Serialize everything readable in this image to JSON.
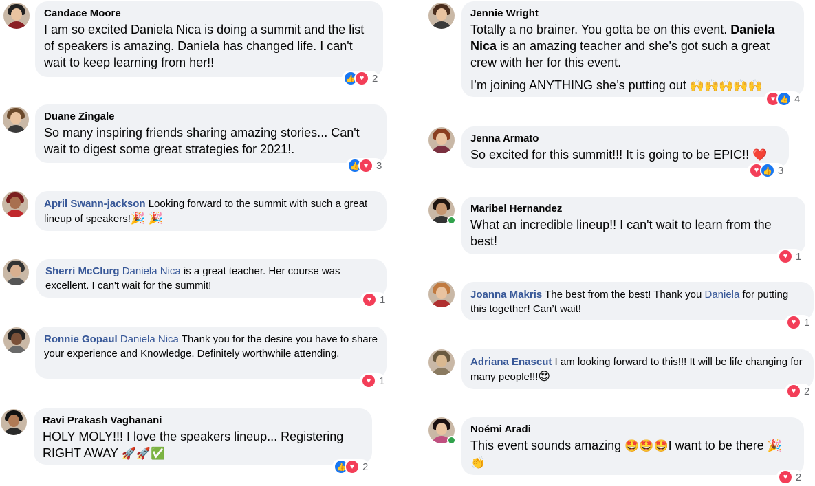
{
  "colors": {
    "bubble": "#f0f2f5",
    "link": "#385898",
    "like": "#1877f2",
    "love": "#f33e58",
    "online": "#31a24c",
    "count": "#65676b"
  },
  "icons": {
    "like": "thumbs-up-icon",
    "love": "heart-icon"
  },
  "comments": [
    {
      "name": "Candace Moore",
      "text": "I am so excited Daniela Nica is doing a summit and the list of speakers is amazing. Daniela has changed life. I can't wait to keep learning from her!!",
      "reaction_count": "2"
    },
    {
      "name": "Duane Zingale",
      "text": "So many inspiring friends sharing amazing stories... Can't wait to digest some great strategies for 2021!.",
      "reaction_count": "3"
    },
    {
      "name": "April Swann-jackson",
      "text": "Looking forward to the summit with such a great lineup of speakers!",
      "emoji": "🎉 🎉"
    },
    {
      "name": "Sherri McClurg",
      "mention": "Daniela Nica",
      "text": "is a great teacher. Her course was excellent. I can't wait for the summit!",
      "reaction_count": "1"
    },
    {
      "name": "Ronnie Gopaul",
      "mention": "Daniela Nica",
      "text": "Thank you for the desire you have to share your experience and Knowledge. Definitely worthwhile attending.",
      "reaction_count": "1"
    },
    {
      "name": "Ravi Prakash Vaghanani",
      "text": "HOLY MOLY!!! I love the speakers lineup... Registering RIGHT AWAY",
      "emoji": "🚀🚀✅",
      "reaction_count": "2"
    },
    {
      "name": "Jennie Wright",
      "text_a": "Totally a no brainer. You gotta be on this event.",
      "mention_bold": "Daniela Nica",
      "text_b": "is an amazing teacher and she’s got such a great crew with her for this event.",
      "text_c": "I’m joining ANYTHING she’s putting out",
      "emoji": "🙌🙌🙌🙌🙌",
      "reaction_count": "4"
    },
    {
      "name": "Jenna Armato",
      "text": "So excited for this summit!!! It is going to be EPIC!!",
      "emoji": "❤️",
      "reaction_count": "3"
    },
    {
      "name": "Maribel Hernandez",
      "text": "What an incredible lineup!! I can't wait to learn from the best!",
      "reaction_count": "1"
    },
    {
      "name": "Joanna Makris",
      "text_a": "The best from the best! Thank you",
      "mention": "Daniela",
      "text_b": "for putting this together! Can’t wait!",
      "reaction_count": "1"
    },
    {
      "name": "Adriana Enascut",
      "text": "I am looking forward to this!!! It will be life changing for many people!!!",
      "emoji": "😍",
      "reaction_count": "2"
    },
    {
      "name": "Noémi Aradi",
      "text_a": "This event sounds amazing",
      "emoji_a": "🤩🤩🤩",
      "text_b": "I want to be there",
      "emoji_b": "🎉",
      "emoji_c": "👏",
      "reaction_count": "2"
    }
  ]
}
